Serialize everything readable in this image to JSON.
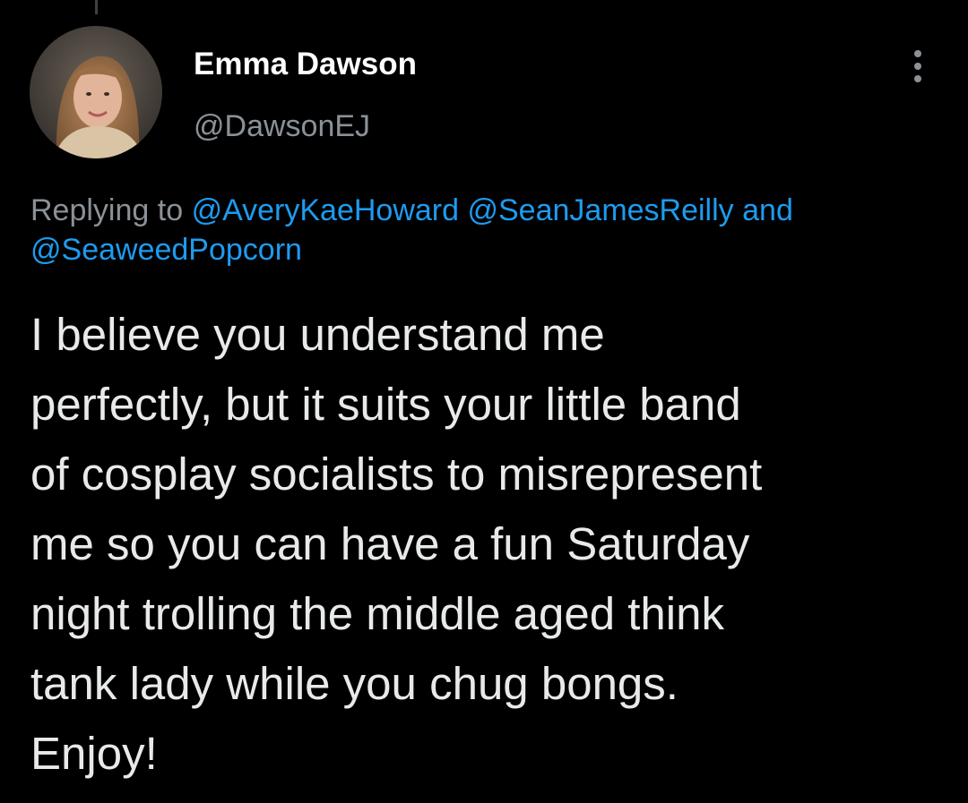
{
  "tweet": {
    "author": {
      "display_name": "Emma Dawson",
      "handle": "@DawsonEJ"
    },
    "more_icon": "vertical-ellipsis",
    "reply": {
      "prefix": "Replying to",
      "mentions": [
        "@AveryKaeHoward",
        "@SeanJamesReilly"
      ],
      "conjunction": "and",
      "last_mention": "@SeaweedPopcorn"
    },
    "text_lines": [
      "I believe you understand me",
      "perfectly, but it suits your little band",
      "of cosplay socialists to misrepresent",
      "me so you can have a fun Saturday",
      "night trolling the middle aged think",
      "tank lady while you chug bongs.",
      "Enjoy!"
    ]
  },
  "colors": {
    "background": "#000000",
    "primary_text": "#e7e9ea",
    "secondary_text": "#8b9196",
    "link": "#1d9bf0"
  }
}
